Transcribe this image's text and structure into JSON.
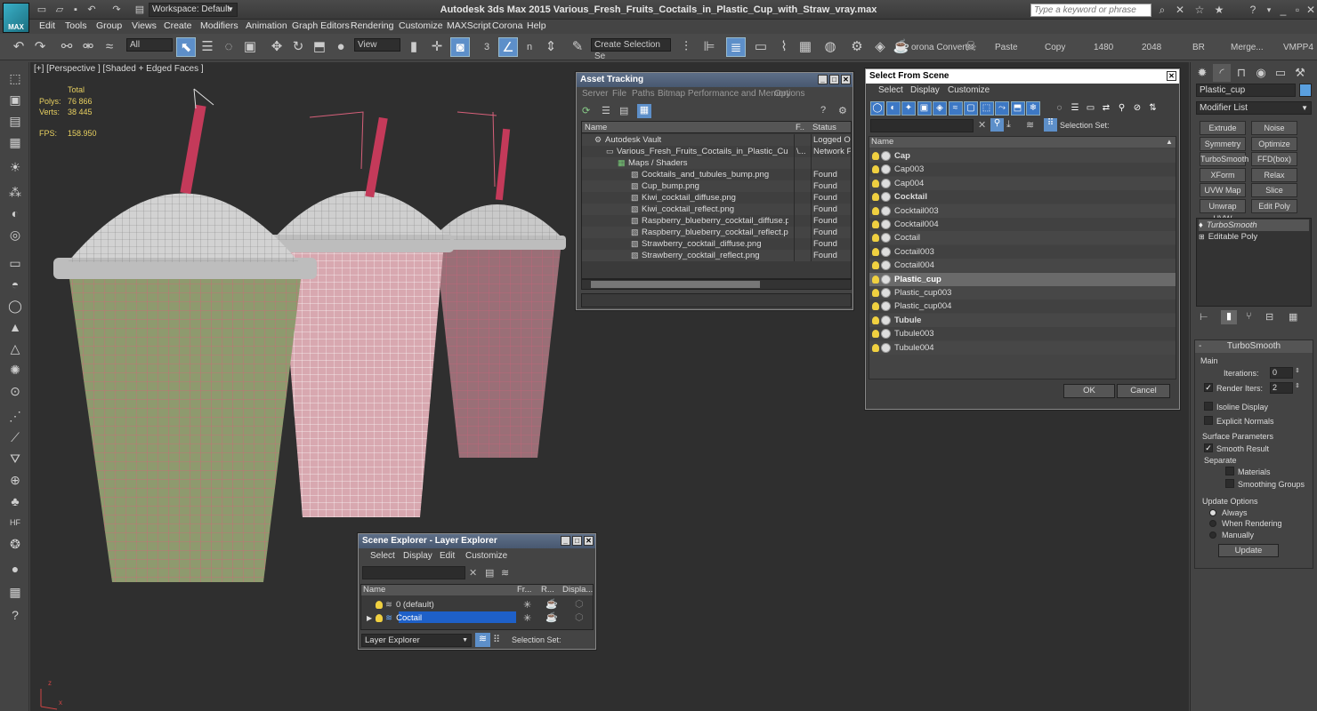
{
  "titlebar": {
    "logo": "MAX",
    "workspace": "Workspace: Default",
    "title": "Autodesk 3ds Max  2015     Various_Fresh_Fruits_Coctails_in_Plastic_Cup_with_Straw_vray.max",
    "search_placeholder": "Type a keyword or phrase"
  },
  "menu": [
    "Edit",
    "Tools",
    "Group",
    "Views",
    "Create",
    "Modifiers",
    "Animation",
    "Graph Editors",
    "Rendering",
    "Customize",
    "MAXScript",
    "Corona",
    "Help"
  ],
  "toolbar": {
    "filter": "All",
    "refcoord": "View",
    "selection_set": "Create Selection Se",
    "corona_convert": "orona Convert",
    "paste": "Paste",
    "copy": "Copy",
    "w": "1480",
    "h": "2048",
    "br": "BR",
    "merge": "Merge...",
    "vmpp": "VMPP4",
    "snap_num": "3",
    "snap_num2": "n"
  },
  "viewport": {
    "label": "[+] [Perspective ] [Shaded + Edged Faces ]",
    "total_label": "Total",
    "polys_label": "Polys:",
    "polys": "76 866",
    "verts_label": "Verts:",
    "verts": "38 445",
    "fps_label": "FPS:",
    "fps": "158.950",
    "axis_z": "z",
    "axis_x": "x",
    "axis_y": "y"
  },
  "asset": {
    "title": "Asset Tracking",
    "menu": [
      "Server",
      "File",
      "Paths",
      "Bitmap Performance and Memory",
      "Options"
    ],
    "col_name": "Name",
    "col_f": "F..",
    "col_status": "Status",
    "rows": [
      {
        "name": "Autodesk Vault",
        "f": "",
        "status": "Logged Out"
      },
      {
        "name": "Various_Fresh_Fruits_Coctails_in_Plastic_Cup_wi...",
        "f": "\\...",
        "status": "Network Pa"
      },
      {
        "name": "Maps / Shaders",
        "f": "",
        "status": ""
      },
      {
        "name": "Cocktails_and_tubules_bump.png",
        "f": "",
        "status": "Found"
      },
      {
        "name": "Cup_bump.png",
        "f": "",
        "status": "Found"
      },
      {
        "name": "Kiwi_cocktail_diffuse.png",
        "f": "",
        "status": "Found"
      },
      {
        "name": "Kiwi_cocktail_reflect.png",
        "f": "",
        "status": "Found"
      },
      {
        "name": "Raspberry_blueberry_cocktail_diffuse.png",
        "f": "",
        "status": "Found"
      },
      {
        "name": "Raspberry_blueberry_cocktail_reflect.png",
        "f": "",
        "status": "Found"
      },
      {
        "name": "Strawberry_cocktail_diffuse.png",
        "f": "",
        "status": "Found"
      },
      {
        "name": "Strawberry_cocktail_reflect.png",
        "f": "",
        "status": "Found"
      }
    ]
  },
  "select": {
    "title": "Select From Scene",
    "menu": [
      "Select",
      "Display",
      "Customize"
    ],
    "selection_set": "Selection Set:",
    "col_name": "Name",
    "items": [
      {
        "name": "Cap",
        "bold": true
      },
      {
        "name": "Cap003",
        "bold": false
      },
      {
        "name": "Cap004",
        "bold": false
      },
      {
        "name": "Cocktail",
        "bold": true
      },
      {
        "name": "Cocktail003",
        "bold": false
      },
      {
        "name": "Cocktail004",
        "bold": false
      },
      {
        "name": "Coctail",
        "bold": false
      },
      {
        "name": "Coctail003",
        "bold": false
      },
      {
        "name": "Coctail004",
        "bold": false
      },
      {
        "name": "Plastic_cup",
        "bold": true
      },
      {
        "name": "Plastic_cup003",
        "bold": false
      },
      {
        "name": "Plastic_cup004",
        "bold": false
      },
      {
        "name": "Tubule",
        "bold": true
      },
      {
        "name": "Tubule003",
        "bold": false
      },
      {
        "name": "Tubule004",
        "bold": false
      }
    ],
    "ok": "OK",
    "cancel": "Cancel"
  },
  "scene": {
    "title": "Scene Explorer - Layer Explorer",
    "menu": [
      "Select",
      "Display",
      "Edit",
      "Customize"
    ],
    "col_name": "Name",
    "col_fr": "Fr...",
    "col_r": "R...",
    "col_disp": "Displa...",
    "layers": [
      "0 (default)",
      "Coctail"
    ],
    "explorer": "Layer Explorer",
    "selection_set": "Selection Set:"
  },
  "cmd": {
    "object_name": "Plastic_cup",
    "modifier_list": "Modifier List",
    "buttons": [
      "Extrude",
      "Noise",
      "Symmetry",
      "Optimize",
      "TurboSmooth",
      "FFD(box)",
      "XForm",
      "Relax",
      "UVW Map",
      "Slice",
      "Unwrap UVW",
      "Edit Poly"
    ],
    "stack": [
      "TurboSmooth",
      "Editable Poly"
    ],
    "rollout": "TurboSmooth",
    "main": "Main",
    "iterations_label": "Iterations:",
    "iterations": "0",
    "render_iters_label": "Render Iters:",
    "render_iters": "2",
    "isoline": "Isoline Display",
    "explicit": "Explicit Normals",
    "surface": "Surface Parameters",
    "smooth": "Smooth Result",
    "separate": "Separate",
    "materials": "Materials",
    "smoothing": "Smoothing Groups",
    "update_opts": "Update Options",
    "always": "Always",
    "when_rendering": "When Rendering",
    "manually": "Manually",
    "update": "Update"
  }
}
